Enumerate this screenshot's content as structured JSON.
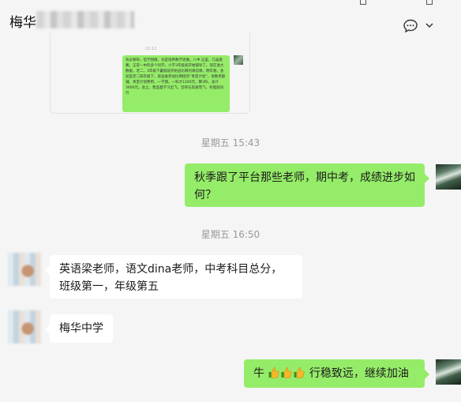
{
  "header": {
    "contact_name": "梅华"
  },
  "forwarded_image": {
    "time": "11:12",
    "text": "有必要呀，但学围棋，也是培养数学思维。八中 这里，几届奥赛，正常一中的多个同学，小学3年级就开始辅导了。现在进大数据，老二，3年级下暑假就开始战比网的课前课，明年春，会就是老二四年级下，就准备参加比网招的“青苗计划”，语数英都辅。青苗计划费用，一学期，一科才1200元，算3科，总计3600元。总之，我监督学习出飞，坚持与高速而飞，有能就同行"
  },
  "messages": [
    {
      "type": "timestamp",
      "text": "星期五 15:43"
    },
    {
      "type": "me",
      "text": "秋季跟了平台那些老师，期中考，成绩进步如何？"
    },
    {
      "type": "timestamp",
      "text": "星期五 16:50"
    },
    {
      "type": "them",
      "text": "英语梁老师，语文dina老师，中考科目总分，班级第一，年级第五"
    },
    {
      "type": "them",
      "text": "梅华中学"
    },
    {
      "type": "me",
      "text_prefix": "牛",
      "text_suffix": "行稳致远，继续加油",
      "emoji": [
        "thumbs-up-icon",
        "thumbs-up-icon",
        "thumbs-up-icon"
      ]
    }
  ],
  "colors": {
    "my_bubble": "#95ec69",
    "their_bubble": "#ffffff",
    "background": "#f5f5f5"
  }
}
